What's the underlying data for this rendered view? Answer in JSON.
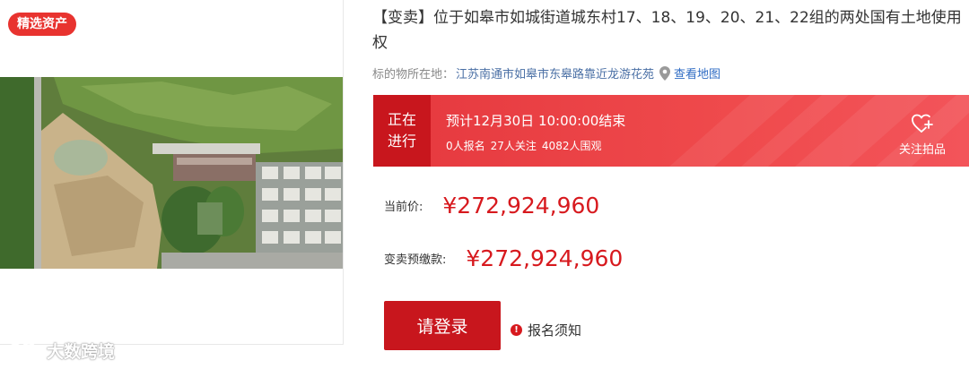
{
  "left": {
    "tag": "精选资产",
    "watermark": "大数跨境"
  },
  "title": "【变卖】位于如皋市如城街道城东村17、18、19、20、21、22组的两处国有土地使用权",
  "location": {
    "label": "标的物所在地：",
    "value": "江苏南通市如皋市东皋路靠近龙游花苑",
    "map_link": "查看地图"
  },
  "banner": {
    "status_line1": "正在",
    "status_line2": "进行",
    "end_time": "预计12月30日 10:00:00结束",
    "signups": "0人报名",
    "followers": "27人关注",
    "viewers": "4082人围观",
    "follow_label": "关注拍品"
  },
  "prices": {
    "current_label": "当前价:",
    "current_value": "¥272,924,960",
    "deposit_label": "变卖预缴款:",
    "deposit_value": "¥272,924,960"
  },
  "actions": {
    "login": "请登录",
    "notice": "报名须知"
  },
  "colors": {
    "accent": "#c8161d",
    "price": "#d7191e",
    "banner": "#ef4a4c"
  },
  "icons": {
    "pin": "map-pin-icon",
    "heart": "heart-plus-icon",
    "alert": "exclamation-icon"
  }
}
